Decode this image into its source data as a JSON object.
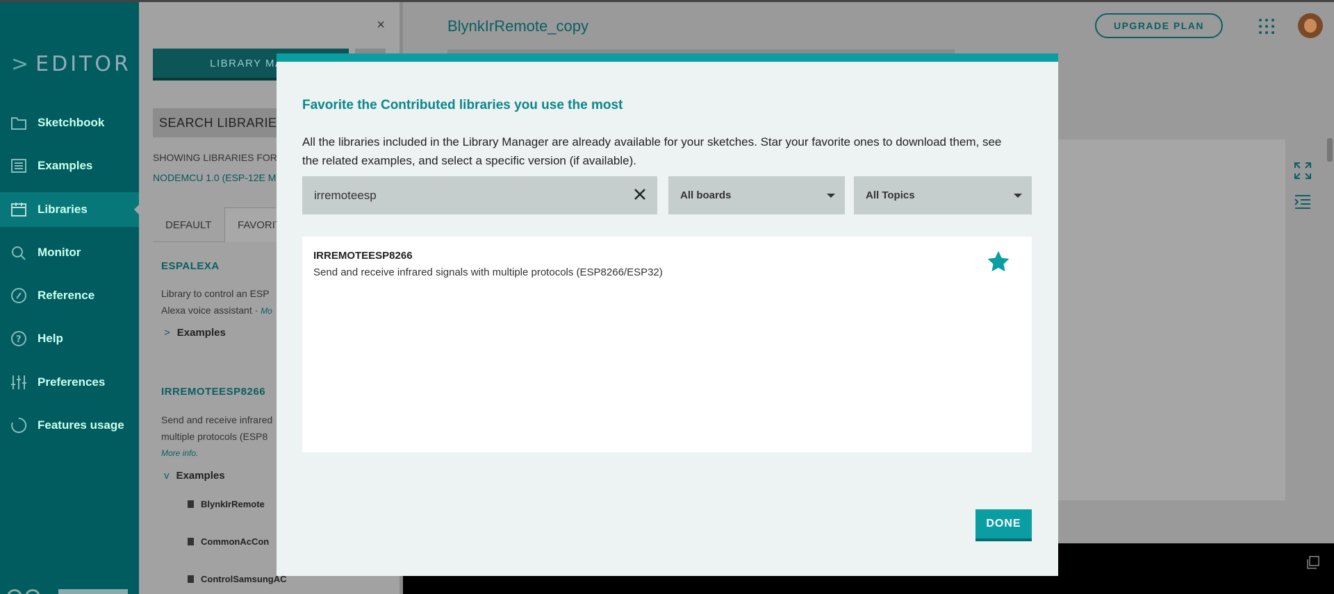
{
  "nav": {
    "brand": "EDITOR",
    "items": [
      {
        "label": "Sketchbook",
        "icon": "folder-icon"
      },
      {
        "label": "Examples",
        "icon": "list-icon"
      },
      {
        "label": "Libraries",
        "icon": "library-icon"
      },
      {
        "label": "Monitor",
        "icon": "monitor-icon"
      },
      {
        "label": "Reference",
        "icon": "compass-icon"
      },
      {
        "label": "Help",
        "icon": "help-icon"
      },
      {
        "label": "Preferences",
        "icon": "sliders-icon"
      },
      {
        "label": "Features usage",
        "icon": "usage-icon"
      }
    ],
    "active_index": 2
  },
  "library_panel": {
    "close_glyph": "×",
    "manager_button": "LIBRARY MAN",
    "search_label": "SEARCH LIBRARIES",
    "showing_label": "SHOWING LIBRARIES FOR",
    "board_label": "NODEMCU 1.0 (ESP-12E M",
    "tabs": {
      "default": "DEFAULT",
      "favorites": "FAVORIT"
    },
    "libraries": [
      {
        "name": "ESPALEXA",
        "desc_line1": "Library to control an ESP",
        "desc_line2": "Alexa voice assistant",
        "more": "Mo",
        "examples_label": "Examples"
      },
      {
        "name": "IRREMOTEESP8266",
        "desc_line1": "Send and receive infrared",
        "desc_line2": "multiple protocols (ESP8",
        "more": "More info.",
        "examples_label": "Examples",
        "files": [
          "BlynkIrRemote",
          "CommonAcCon",
          "ControlSamsungAC"
        ]
      }
    ]
  },
  "editor": {
    "sketch_title": "BlynkIrRemote_copy",
    "upgrade_label": "UPGRADE PLAN"
  },
  "modal": {
    "heading": "Favorite the Contributed libraries you use the most",
    "description": "All the libraries included in the Library Manager are already available for your sketches. Star your favorite ones to download them, see the related examples, and select a specific version (if available).",
    "search_value": "irremoteesp",
    "boards_select": "All boards",
    "topics_select": "All Topics",
    "results": [
      {
        "name": "IRREMOTEESP8266",
        "description": "Send and receive infrared signals with multiple protocols (ESP8266/ESP32)",
        "starred": true
      }
    ],
    "done_label": "DONE"
  },
  "colors": {
    "accent": "#0a9ea3",
    "nav_bg": "#005c5f",
    "heading_teal": "#0a878b"
  }
}
